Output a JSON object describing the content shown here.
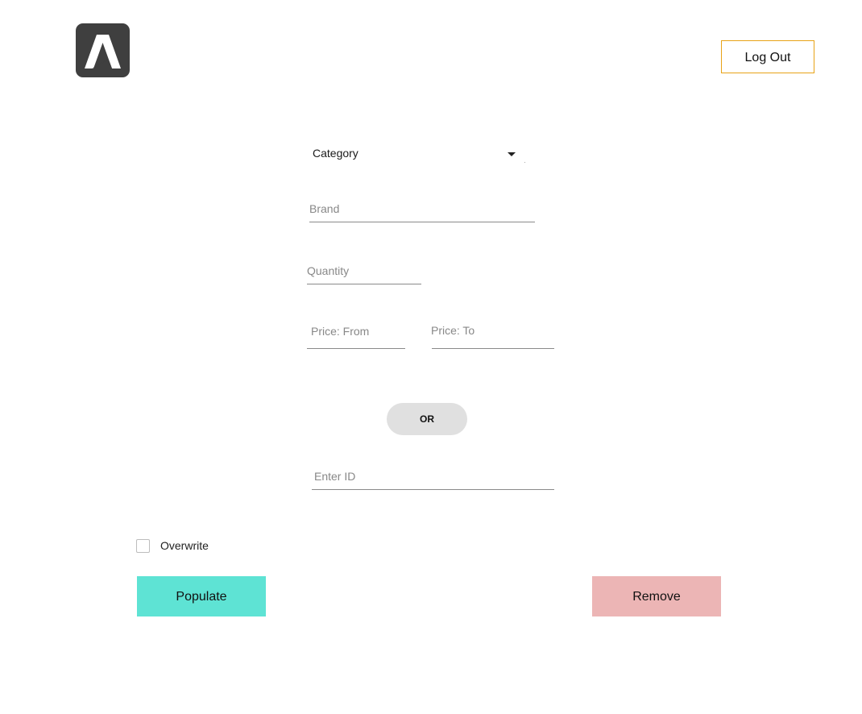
{
  "header": {
    "logo_icon": "letter-a-logo-icon",
    "logout_label": "Log Out"
  },
  "form": {
    "category": {
      "label": "Category",
      "icon": "caret-down-icon"
    },
    "brand": {
      "placeholder": "Brand",
      "value": ""
    },
    "quantity": {
      "placeholder": "Quantity",
      "value": ""
    },
    "price_from": {
      "placeholder": "Price: From",
      "value": ""
    },
    "price_to": {
      "placeholder": "Price: To",
      "value": ""
    },
    "separator": "OR",
    "enter_id": {
      "placeholder": "Enter ID",
      "value": ""
    }
  },
  "options": {
    "overwrite_label": "Overwrite",
    "overwrite_checked": false
  },
  "actions": {
    "populate_label": "Populate",
    "remove_label": "Remove"
  },
  "colors": {
    "logo_bg": "#3f3f3f",
    "logout_border": "#e8a317",
    "populate_bg": "#5ee3d4",
    "remove_bg": "#ecb5b5",
    "or_pill_bg": "#e0e0e0"
  }
}
